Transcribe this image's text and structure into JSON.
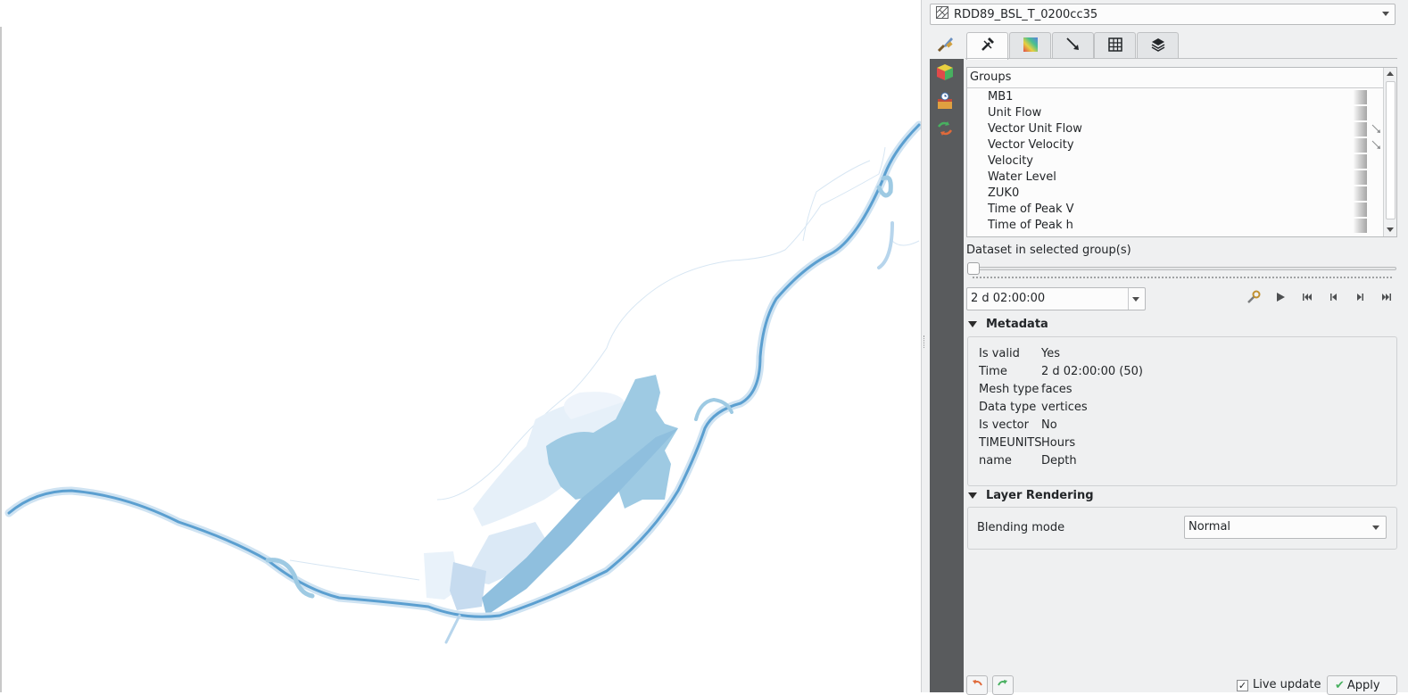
{
  "layer_selector": {
    "name": "RDD89_BSL_T_0200cc35"
  },
  "tabs": [
    {
      "icon": "hammer-icon",
      "active": true
    },
    {
      "icon": "color-ramp-icon",
      "active": false
    },
    {
      "icon": "vector-arrow-icon",
      "active": false
    },
    {
      "icon": "mesh-grid-icon",
      "active": false
    },
    {
      "icon": "layers-icon",
      "active": false
    }
  ],
  "groups": {
    "header": "Groups",
    "items": [
      {
        "label": "MB1",
        "vector": false
      },
      {
        "label": "Unit Flow",
        "vector": false
      },
      {
        "label": "Vector Unit Flow",
        "vector": true
      },
      {
        "label": "Vector Velocity",
        "vector": true
      },
      {
        "label": "Velocity",
        "vector": false
      },
      {
        "label": "Water Level",
        "vector": false
      },
      {
        "label": "ZUK0",
        "vector": false
      },
      {
        "label": "Time of Peak V",
        "vector": false
      },
      {
        "label": "Time of Peak h",
        "vector": false
      }
    ]
  },
  "dataset": {
    "label": "Dataset in selected group(s)",
    "time_value": "2 d 02:00:00",
    "slider_position": 0.0
  },
  "metadata": {
    "title": "Metadata",
    "rows": [
      {
        "key": "Is valid",
        "value": "Yes"
      },
      {
        "key": "Time",
        "value": "2 d 02:00:00 (50)"
      },
      {
        "key": "Mesh type",
        "value": "faces"
      },
      {
        "key": "Data type",
        "value": "vertices"
      },
      {
        "key": "Is vector",
        "value": "No"
      },
      {
        "key": "TIMEUNITS",
        "value": "Hours"
      },
      {
        "key": "name",
        "value": "Depth"
      }
    ]
  },
  "layer_rendering": {
    "title": "Layer Rendering",
    "blending_label": "Blending mode",
    "blending_value": "Normal"
  },
  "footer": {
    "live_update_label": "Live update",
    "live_update_checked": true,
    "apply_label": "Apply"
  },
  "colors": {
    "river": "#5b9fd0",
    "flood_dark": "#9ecae3",
    "flood_light": "#dbe9f6",
    "panel_bg": "#eff0f1",
    "side_strip": "#595b5d"
  }
}
